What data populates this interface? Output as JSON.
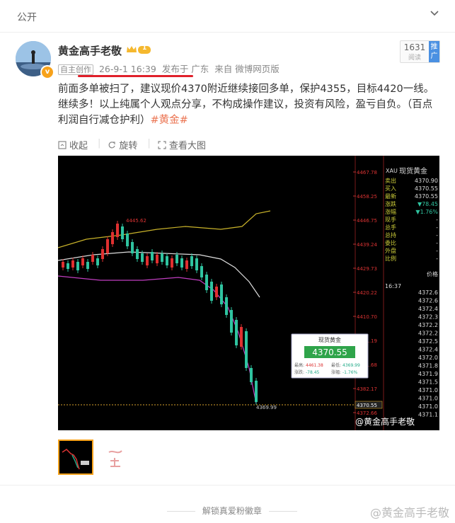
{
  "topbar": {
    "label": "公开"
  },
  "post": {
    "author": "黄金高手老敬",
    "level": "1",
    "original_tag": "自主创作",
    "time": "26-9-1 16:39",
    "location": "发布于 广东",
    "source": "来自 微博网页版",
    "reads_count": "1631",
    "reads_label": "阅读",
    "promote_label": "推广",
    "text_main": "前面多单被扫了，建议现价4370附近继续接回多单，保护4355，目标4420一线。继续多！以上纯属个人观点分享，不构成操作建议，投资有风险，盈亏自负。（百点利润自行减仓护利）",
    "hashtag": "#黄金#"
  },
  "actions": [
    {
      "label": "收起"
    },
    {
      "label": "旋转"
    },
    {
      "label": "查看大图"
    }
  ],
  "chart_image": {
    "panel_title": "现货黄金",
    "symbol": "XAU",
    "quote_rows": [
      {
        "k": "卖出",
        "v": "4370.90"
      },
      {
        "k": "买入",
        "v": "4370.55"
      },
      {
        "k": "最新",
        "v": "4370.55"
      },
      {
        "k": "涨跌",
        "v": "▼78.45"
      },
      {
        "k": "涨幅",
        "v": "▼1.76%"
      },
      {
        "k": "现手",
        "v": "-"
      },
      {
        "k": "总手",
        "v": "-"
      },
      {
        "k": "总持",
        "v": "-"
      },
      {
        "k": "委比",
        "v": "-"
      },
      {
        "k": "外盘",
        "v": "-"
      },
      {
        "k": "比例",
        "v": "-"
      }
    ],
    "price_ticks": [
      "4467.78",
      "4458.25",
      "4446.75",
      "4439.24",
      "4429.73",
      "4420.22",
      "4410.70",
      "4401.19",
      "4391.68",
      "4382.17",
      "4372.66"
    ],
    "time_label": "16:37",
    "high_label": "4445.62",
    "low_label": "4369.99",
    "current_price_tag": "4370.55",
    "popup": {
      "title": "现货黄金",
      "price": "4370.55",
      "high_k": "最高:",
      "high_v": "4461.38",
      "low_k": "最低:",
      "low_v": "4369.99",
      "chg_k": "涨跌:",
      "chg_v": "-78.45",
      "pct_k": "涨幅:",
      "pct_v": "-1.76%"
    },
    "ticks_right": [
      "4372.6",
      "4372.6",
      "4372.4",
      "4372.3",
      "4372.2",
      "4372.2",
      "4372.5",
      "4372.4",
      "4372.0",
      "4371.8",
      "4371.9",
      "4371.5",
      "4371.0",
      "4371.0",
      "4371.0",
      "4371.1"
    ],
    "price_col_label": "价格",
    "watermark": "@黄金高手老敬"
  },
  "footer": {
    "unlock_label": "解锁真爱粉徽章",
    "watermark": "@黄金高手老敬"
  },
  "colors": {
    "accent": "#eb7350",
    "red_underline": "#e0202a",
    "badge": "#f7a21b"
  }
}
